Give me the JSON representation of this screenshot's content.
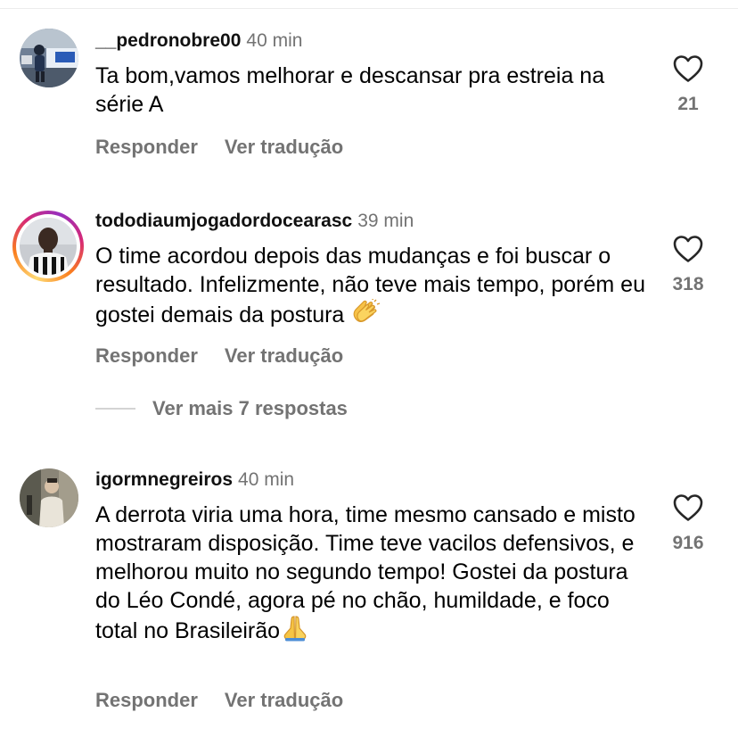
{
  "comments": [
    {
      "username": "__pedronobre00",
      "time": "40 min",
      "text": "Ta bom,vamos melhorar e descansar pra estreia na série A",
      "likes": "21",
      "reply_label": "Responder",
      "translate_label": "Ver tradução",
      "has_story_ring": false,
      "avatar_icon": "avatar-photo"
    },
    {
      "username": "tododiaumjogadordocearasc",
      "time": "39 min",
      "text": "O time acordou depois das mudanças e foi buscar o resultado. Infelizmente, não teve mais tempo, porém eu gostei demais da postura",
      "text_emoji": "clapping-hands-emoji",
      "likes": "318",
      "reply_label": "Responder",
      "translate_label": "Ver tradução",
      "has_story_ring": true,
      "avatar_icon": "avatar-photo"
    },
    {
      "username": "igormnegreiros",
      "time": "40 min",
      "text": "A derrota viria uma hora, time mesmo cansado e misto mostraram disposição. Time teve vacilos defensivos, e melhorou muito no segundo tempo! Gostei da postura do Léo Condé, agora pé no chão, humildade, e foco total no Brasileirão",
      "text_emoji": "folded-hands-emoji",
      "likes": "916",
      "reply_label": "Responder",
      "translate_label": "Ver tradução",
      "has_story_ring": false,
      "avatar_icon": "avatar-photo"
    }
  ],
  "view_more_replies": "Ver mais 7 respostas",
  "colors": {
    "secondary_text": "#737373",
    "story_ring_start": "#feda75",
    "story_ring_end": "#d62976"
  },
  "icons": {
    "like": "heart-outline-icon"
  }
}
